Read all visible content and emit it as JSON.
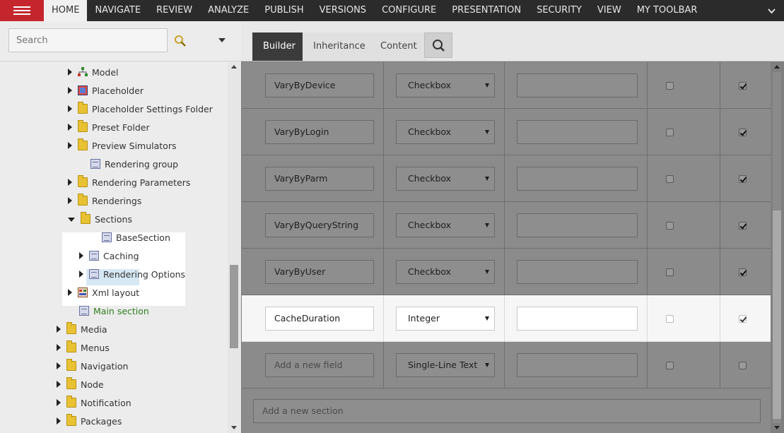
{
  "menu": {
    "items": [
      "HOME",
      "NAVIGATE",
      "REVIEW",
      "ANALYZE",
      "PUBLISH",
      "VERSIONS",
      "CONFIGURE",
      "PRESENTATION",
      "SECURITY",
      "VIEW",
      "MY TOOLBAR"
    ],
    "active": "HOME"
  },
  "search": {
    "placeholder": "Search"
  },
  "tree": {
    "items": [
      {
        "label": "Model",
        "icon": "model-icon",
        "expander": "collapsed"
      },
      {
        "label": "Placeholder",
        "icon": "placeholder-icon",
        "expander": "collapsed"
      },
      {
        "label": "Placeholder Settings Folder",
        "icon": "folder-icon",
        "expander": "collapsed"
      },
      {
        "label": "Preset Folder",
        "icon": "folder-icon",
        "expander": "collapsed"
      },
      {
        "label": "Preview Simulators",
        "icon": "folder-icon",
        "expander": "collapsed"
      },
      {
        "label": "Rendering group",
        "icon": "document-icon",
        "expander": "none"
      },
      {
        "label": "Rendering Parameters",
        "icon": "folder-icon",
        "expander": "collapsed"
      },
      {
        "label": "Renderings",
        "icon": "folder-icon",
        "expander": "collapsed"
      },
      {
        "label": "Sections",
        "icon": "folder-icon",
        "expander": "expanded"
      },
      {
        "label": "BaseSection",
        "icon": "document-icon",
        "expander": "none"
      },
      {
        "label": "Caching",
        "icon": "document-icon",
        "expander": "collapsed",
        "selected": true
      },
      {
        "label": "Rendering Options",
        "icon": "document-icon",
        "expander": "collapsed"
      },
      {
        "label": "Xml layout",
        "icon": "xml-layout-icon",
        "expander": "collapsed"
      },
      {
        "label": "Main section",
        "icon": "document-icon",
        "expander": "none"
      },
      {
        "label": "Media",
        "icon": "folder-icon",
        "expander": "collapsed"
      },
      {
        "label": "Menus",
        "icon": "folder-icon",
        "expander": "collapsed"
      },
      {
        "label": "Navigation",
        "icon": "folder-icon",
        "expander": "collapsed"
      },
      {
        "label": "Node",
        "icon": "folder-icon",
        "expander": "collapsed"
      },
      {
        "label": "Notification",
        "icon": "folder-icon",
        "expander": "collapsed"
      },
      {
        "label": "Packages",
        "icon": "folder-icon",
        "expander": "collapsed"
      }
    ]
  },
  "tabs": [
    {
      "label": "Builder",
      "active": true
    },
    {
      "label": "Inheritance",
      "active": false
    },
    {
      "label": "Content",
      "active": false
    }
  ],
  "fields": [
    {
      "name": "VaryByDevice",
      "type": "Checkbox",
      "source": "",
      "unversioned": false,
      "shared": true
    },
    {
      "name": "VaryByLogin",
      "type": "Checkbox",
      "source": "",
      "unversioned": false,
      "shared": true
    },
    {
      "name": "VaryByParm",
      "type": "Checkbox",
      "source": "",
      "unversioned": false,
      "shared": true
    },
    {
      "name": "VaryByQueryString",
      "type": "Checkbox",
      "source": "",
      "unversioned": false,
      "shared": true
    },
    {
      "name": "VaryByUser",
      "type": "Checkbox",
      "source": "",
      "unversioned": false,
      "shared": true
    },
    {
      "name": "CacheDuration",
      "type": "Integer",
      "source": "",
      "unversioned": false,
      "shared": true,
      "highlighted": true
    }
  ],
  "new_field": {
    "placeholder": "Add a new field",
    "type": "Single-Line Text",
    "unversioned": false,
    "shared": false
  },
  "new_section": {
    "placeholder": "Add a new section"
  },
  "colors": {
    "brand": "#c5262d",
    "topbar": "#2b2b2b",
    "main_section_text": "#2e7d1e",
    "selected": "#d7e8f5"
  }
}
